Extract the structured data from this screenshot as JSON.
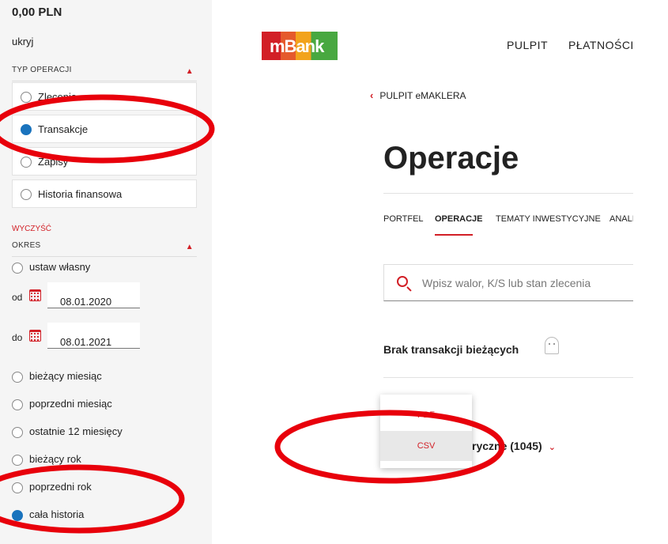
{
  "sidebar": {
    "balance": "0,00 PLN",
    "hide_link": "ukryj",
    "operation_type": {
      "header": "TYP OPERACJI",
      "items": [
        {
          "label": "Zlecenia",
          "selected": false
        },
        {
          "label": "Transakcje",
          "selected": true
        },
        {
          "label": "Zapisy",
          "selected": false
        },
        {
          "label": "Historia finansowa",
          "selected": false
        }
      ]
    },
    "clear_link": "WYCZYŚĆ",
    "period": {
      "header": "OKRES",
      "custom_label": "ustaw własny",
      "from_label": "od",
      "from_value": "08.01.2020",
      "to_label": "do",
      "to_value": "08.01.2021",
      "options": [
        {
          "label": "bieżący miesiąc",
          "selected": false
        },
        {
          "label": "poprzedni miesiąc",
          "selected": false
        },
        {
          "label": "ostatnie 12 miesięcy",
          "selected": false
        },
        {
          "label": "bieżący rok",
          "selected": false
        },
        {
          "label": "poprzedni rok",
          "selected": false
        },
        {
          "label": "cała historia",
          "selected": true
        }
      ]
    }
  },
  "header": {
    "logo_text": "mBank",
    "nav": [
      "PULPIT",
      "PŁATNOŚCI"
    ]
  },
  "main": {
    "back_label": "PULPIT eMAKLERA",
    "title": "Operacje",
    "tabs": [
      "PORTFEL",
      "OPERACJE",
      "TEMATY INWESTYCYJNE",
      "ANALIZY"
    ],
    "active_tab": "OPERACJE",
    "search_placeholder": "Wpisz walor, K/S lub stan zlecenia",
    "empty_label": "Brak transakcji bieżących",
    "history_label": "ryczne (1045)",
    "export_menu": [
      "PDF",
      "CSV"
    ]
  },
  "colors": {
    "accent": "#d21f26",
    "radio_selected": "#1a73bd",
    "annotation": "#e8000b"
  }
}
